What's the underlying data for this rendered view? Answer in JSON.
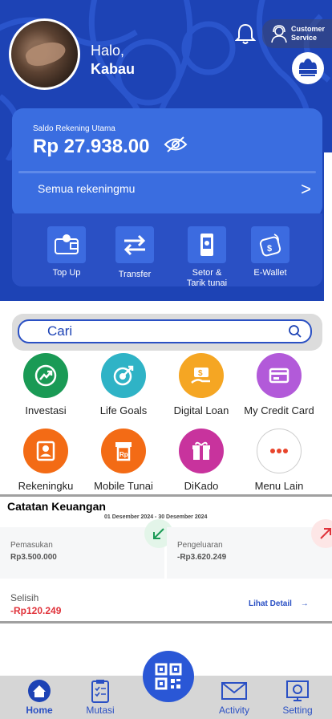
{
  "header": {
    "greeting": "Halo,",
    "user_name": "Kabau",
    "customer_service_line1": "Customer",
    "customer_service_line2": "Service"
  },
  "balance": {
    "label": "Saldo Rekening Utama",
    "amount": "Rp 27.938.00",
    "all_accounts": "Semua rekeningmu",
    "chevron": ">"
  },
  "quick_actions": [
    {
      "label": "Top Up",
      "icon": "wallet-icon"
    },
    {
      "label": "Transfer",
      "icon": "transfer-arrows-icon"
    },
    {
      "label_line1": "Setor &",
      "label_line2": "Tarik tunai",
      "icon": "atm-icon"
    },
    {
      "label": "E-Wallet",
      "icon": "e-wallet-icon"
    }
  ],
  "search": {
    "placeholder": "Cari"
  },
  "menu": [
    {
      "label": "Investasi",
      "icon": "chart-up-icon",
      "color": "#1a9a55"
    },
    {
      "label": "Life Goals",
      "icon": "target-icon",
      "color": "#2fb3c6"
    },
    {
      "label": "Digital Loan",
      "icon": "loan-icon",
      "color": "#f5a623"
    },
    {
      "label": "My Credit Card",
      "icon": "credit-card-icon",
      "color": "#b25ad9"
    },
    {
      "label": "Rekeningku",
      "icon": "account-icon",
      "color": "#f36b15"
    },
    {
      "label": "Mobile Tunai",
      "icon": "mobile-cash-icon",
      "color": "#f36b15"
    },
    {
      "label": "DiKado",
      "icon": "gift-icon",
      "color": "#c8339d"
    },
    {
      "label": "Menu Lain",
      "icon": "more-icon",
      "color": "#ffffff"
    }
  ],
  "finance": {
    "title": "Catatan Keuangan",
    "period": "01 Desember 2024 - 30 Desember 2024",
    "income_label": "Pemasukan",
    "income_value": "Rp3.500.000",
    "expense_label": "Pengeluaran",
    "expense_value": "-Rp3.620.249",
    "diff_label": "Selisih",
    "diff_value": "-Rp120.249",
    "detail_link": "Lihat Detail",
    "detail_arrow": "→"
  },
  "bottom_nav": [
    {
      "label": "Home",
      "icon": "home-icon",
      "active": true
    },
    {
      "label": "Mutasi",
      "icon": "clipboard-icon"
    },
    {
      "label": "Activity",
      "icon": "envelope-icon"
    },
    {
      "label": "Setting",
      "icon": "settings-monitor-icon"
    }
  ],
  "colors": {
    "primary": "#1d43b5",
    "card": "#3a6de0",
    "negative": "#e0323a"
  }
}
